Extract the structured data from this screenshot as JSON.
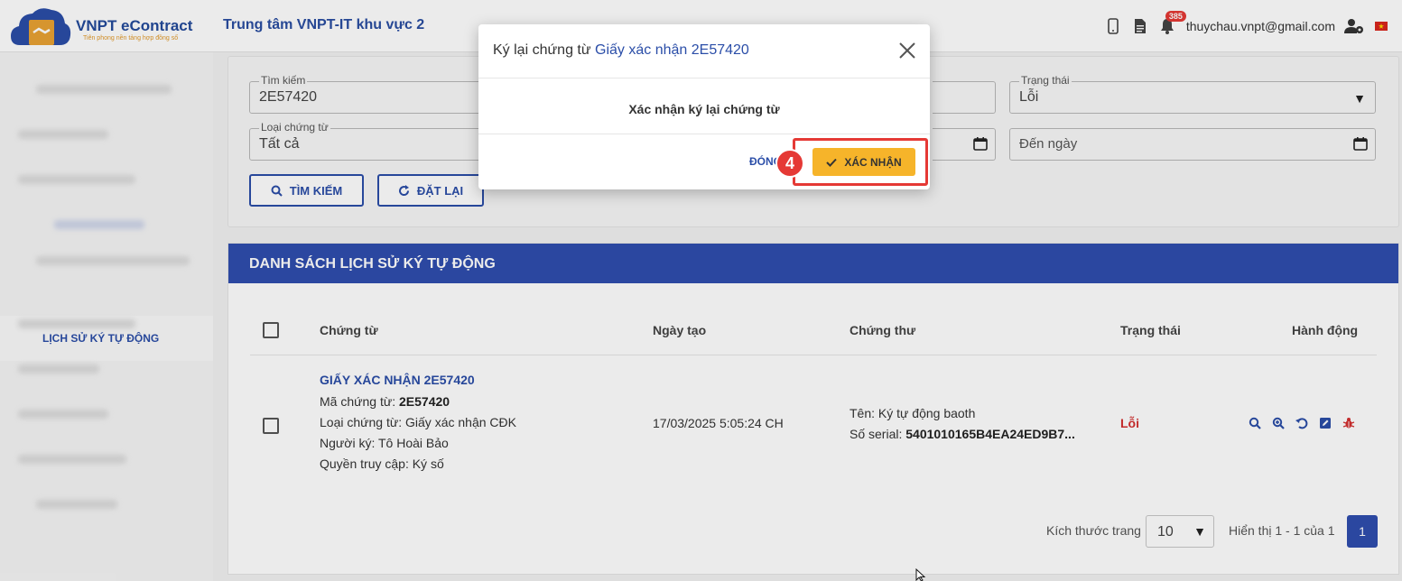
{
  "header": {
    "logo_title": "VNPT eContract",
    "logo_subtitle": "Tiên phong nền tảng hợp đồng số",
    "org_name": "Trung tâm VNPT-IT khu vực 2",
    "notification_count": "385",
    "user_email": "thuychau.vnpt@gmail.com",
    "icons": [
      "mobile-icon",
      "document-icon",
      "bell-icon",
      "user-settings-icon",
      "vietnam-flag-icon"
    ]
  },
  "sidebar": {
    "active_item": "LỊCH SỬ KÝ TỰ ĐỘNG"
  },
  "search": {
    "keyword_label": "Tìm kiếm",
    "keyword_value": "2E57420",
    "status_label": "Trạng thái",
    "status_value": "Lỗi",
    "doc_type_label": "Loại chứng từ",
    "doc_type_value": "Tất cả",
    "to_date_placeholder": "Đến ngày",
    "search_button": "TÌM KIẾM",
    "reset_button": "ĐẶT LẠI"
  },
  "list": {
    "title": "DANH SÁCH LỊCH SỬ KÝ TỰ ĐỘNG",
    "columns": [
      "Chứng từ",
      "Ngày tạo",
      "Chứng thư",
      "Trạng thái",
      "Hành động"
    ],
    "rows": [
      {
        "doc_name": "GIẤY XÁC NHẬN 2E57420",
        "doc_code_label": "Mã chứng từ: ",
        "doc_code": "2E57420",
        "doc_type": "Loại chứng từ: Giấy xác nhận CĐK",
        "signer": "Người ký: Tô Hoài Bảo",
        "access": "Quyền truy cập: Ký số",
        "created": "17/03/2025 5:05:24 CH",
        "cert_name": "Tên: Ký tự động baoth",
        "serial_label": "Số serial: ",
        "serial": "5401010165B4EA24ED9B7...",
        "status": "Lỗi"
      }
    ]
  },
  "pagination": {
    "page_size_label": "Kích thước trang",
    "page_size": "10",
    "info": "Hiển thị 1 - 1 của 1",
    "current_page": "1"
  },
  "modal": {
    "title_prefix": "Ký lại chứng từ ",
    "title_doc": "Giấy xác nhận 2E57420",
    "message": "Xác nhận ký lại chứng từ",
    "close_label": "ĐÓNG",
    "confirm_label": "XÁC NHẬN"
  },
  "annotation": {
    "step": "4",
    "color": "#e53935"
  }
}
